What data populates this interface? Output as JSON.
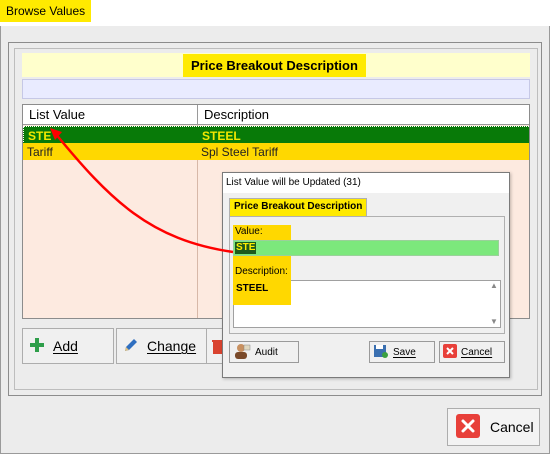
{
  "window": {
    "title": "Browse Values"
  },
  "panel": {
    "header_label": "Price Breakout Description"
  },
  "grid": {
    "columns": [
      "List Value",
      "Description"
    ],
    "rows": [
      {
        "value": "STE",
        "description": "STEEL",
        "selected": true
      },
      {
        "value": "Tariff",
        "description": "Spl Steel Tariff",
        "selected": false
      }
    ]
  },
  "buttons": {
    "add": "Add",
    "change": "Change",
    "cancel": "Cancel"
  },
  "dialog": {
    "title": "List Value will be Updated  (31)",
    "tab": "Price Breakout Description",
    "value_label": "Value:",
    "value": "STE",
    "description_label": "Description:",
    "description": "STEEL",
    "audit": "Audit",
    "save": "Save",
    "cancel": "Cancel"
  },
  "colors": {
    "highlight_yellow": "#ffea00",
    "selected_row_green": "#087a08",
    "selected_text": "#f2e800",
    "grid_bg": "#fdeae0",
    "annotation_arrow": "#ff0000"
  },
  "icons": [
    "plus-icon",
    "pencil-icon",
    "delete-icon",
    "cancel-x-icon",
    "audit-person-icon",
    "save-disk-icon"
  ]
}
